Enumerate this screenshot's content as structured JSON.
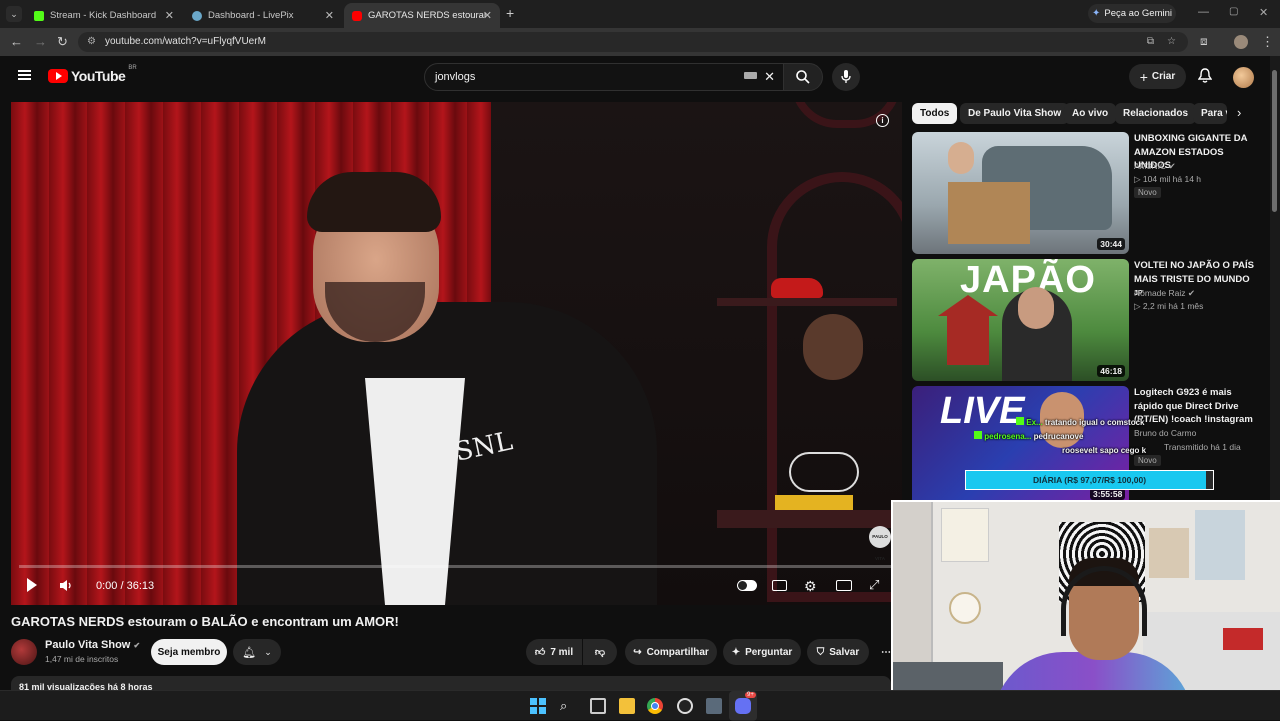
{
  "browser": {
    "tabs": [
      {
        "label": "Stream - Kick Dashboard",
        "fav_color": "#53fc18"
      },
      {
        "label": "Dashboard - LivePix",
        "fav_color": "#6aa7c8"
      },
      {
        "label": "GAROTAS NERDS estouram o B",
        "fav_color": "#ff0000"
      }
    ],
    "new_tab": "+",
    "gemini_label": "Peça ao Gemini",
    "url": "youtube.com/watch?v=uFlyqfVUerM"
  },
  "youtube": {
    "logo_text": "YouTube",
    "region": "BR",
    "search_value": "jonvlogs",
    "create_label": "Criar"
  },
  "player": {
    "time": "0:00 / 36:13",
    "stream_name": "PAULO VITA"
  },
  "video": {
    "title": "GAROTAS NERDS estouram o BALÃO e encontram um AMOR!",
    "channel": "Paulo Vita Show",
    "subscribers": "1,47 mi de inscritos",
    "member_label": "Seja membro",
    "likes": "7 mil",
    "share_label": "Compartilhar",
    "ask_label": "Perguntar",
    "save_label": "Salvar",
    "views_partial": "81 mil visualizações  há 8 horas"
  },
  "chips": [
    "Todos",
    "De Paulo Vita Show",
    "Ao vivo",
    "Relacionados",
    "Para v"
  ],
  "recommendations": [
    {
      "title": "UNBOXING GIGANTE DA AMAZON ESTADOS UNIDOS",
      "channel": "AM3NIC",
      "meta": "104 mil  há 14 h",
      "badge": "Novo",
      "duration": "30:44"
    },
    {
      "title": "VOLTEI NO JAPÃO O PAÍS MAIS TRISTE DO MUNDO",
      "title_suffix": "JP",
      "thumb_text": "JAPÃO",
      "channel": "Nômade Raiz",
      "meta": "2,2 mi  há 1 mês",
      "duration": "46:18"
    },
    {
      "title": "Logitech G923 é mais rápido que Direct Drive (PT/EN) !coach !instagram",
      "thumb_text": "LIVE",
      "channel": "Bruno do Carmo",
      "meta": "Transmitido há 1 dia",
      "badge": "Novo",
      "duration": "3:55:58"
    }
  ],
  "overlay": {
    "chat": [
      {
        "user": "Ex...",
        "text": "tratando igual o comstock"
      },
      {
        "user": "pedrosena...",
        "text": "pedrucanove"
      },
      {
        "user": "",
        "text": "roosevelt sapo cego k"
      }
    ],
    "goal_label": "DIÁRIA (R$ 97,07/R$ 100,00)",
    "goal_progress": 0.9707
  },
  "taskbar": {
    "discord_badge": "9+"
  },
  "colors": {
    "yt_red": "#ff0000",
    "kick_green": "#53fc18",
    "goal_cyan": "#19c8f0"
  }
}
